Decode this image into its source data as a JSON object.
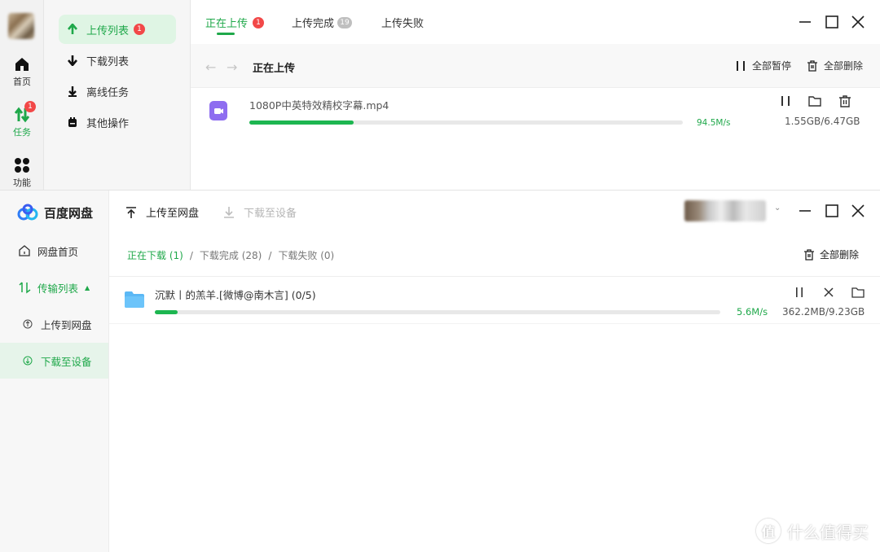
{
  "top_window": {
    "rail": {
      "home_label": "首页",
      "tasks_label": "任务",
      "tasks_badge": "1",
      "functions_label": "功能"
    },
    "sidebar": {
      "items": [
        {
          "label": "上传列表",
          "badge": "1",
          "active": true
        },
        {
          "label": "下载列表"
        },
        {
          "label": "离线任务"
        },
        {
          "label": "其他操作"
        }
      ]
    },
    "tabs": [
      {
        "label": "正在上传",
        "badge": "1",
        "active": true
      },
      {
        "label": "上传完成",
        "badge": "19"
      },
      {
        "label": "上传失败"
      }
    ],
    "toolbar": {
      "title": "正在上传",
      "pause_all": "全部暂停",
      "delete_all": "全部删除"
    },
    "task": {
      "file_name": "1080P中英特效精校字幕.mp4",
      "progress": 0.24,
      "speed": "94.5M/s",
      "size": "1.55GB/6.47GB"
    },
    "colors": {
      "accent": "#1fa84a",
      "badge": "#f24848",
      "file_icon": "#8e6df0"
    }
  },
  "bottom_window": {
    "app_name": "百度网盘",
    "sidebar": {
      "home": "网盘首页",
      "transfer": "传输列表",
      "upload": "上传到网盘",
      "download": "下载至设备"
    },
    "top_actions": {
      "upload": "上传至网盘",
      "download": "下载至设备"
    },
    "tabs": {
      "downloading": "正在下载 (1)",
      "completed": "下载完成 (28)",
      "failed": "下载失败 (0)",
      "separator": "/"
    },
    "delete_all": "全部删除",
    "task": {
      "file_name": "沉默丨的羔羊.[微博@南木言] (0/5)",
      "progress": 0.04,
      "speed": "5.6M/s",
      "size": "362.2MB/9.23GB"
    }
  },
  "watermark": {
    "text": "什么值得买",
    "logo_char": "值"
  }
}
